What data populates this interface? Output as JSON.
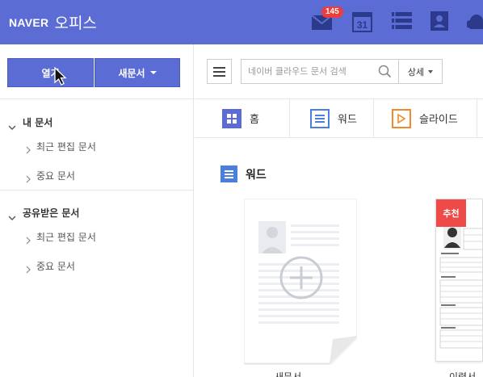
{
  "header": {
    "brand_naver": "NAVER",
    "brand_office": "오피스",
    "mail_badge": "145",
    "calendar_day": "31"
  },
  "sidebar": {
    "open_button": "열기",
    "new_doc_button": "새문서",
    "sections": [
      {
        "title": "내 문서",
        "items": [
          "최근 편집 문서",
          "중요 문서"
        ]
      },
      {
        "title": "공유받은 문서",
        "items": [
          "최근 편집 문서",
          "중요 문서"
        ]
      }
    ]
  },
  "toolbar": {
    "search_placeholder": "네이버 클라우드 문서 검색",
    "detail_label": "상세"
  },
  "tabs": [
    {
      "label": "홈",
      "icon": "grid-icon"
    },
    {
      "label": "워드",
      "icon": "word-icon"
    },
    {
      "label": "슬라이드",
      "icon": "slide-icon"
    }
  ],
  "content": {
    "section_title": "워드",
    "new_doc_label": "새문서",
    "recommend_badge": "추천",
    "resume_label": "이력서"
  },
  "colors": {
    "header_bg": "#5b6cd4",
    "accent_blue": "#4a7fe0",
    "slide_orange": "#f08a2a",
    "badge_red": "#ee3b3b"
  }
}
